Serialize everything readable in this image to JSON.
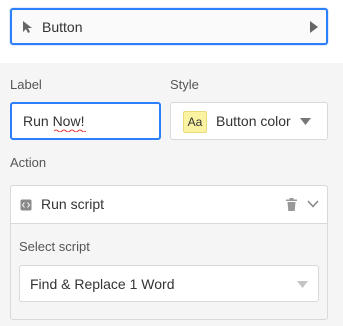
{
  "element": {
    "name": "Button"
  },
  "label_field": {
    "label": "Label",
    "value": "Run Now!"
  },
  "style_field": {
    "label": "Style",
    "swatch_text": "Aa",
    "value": "Button color",
    "swatch_color": "#fcf3a2"
  },
  "action_section": {
    "label": "Action",
    "action_title": "Run script",
    "select_label": "Select script",
    "selected_script": "Find & Replace 1 Word"
  },
  "colors": {
    "accent": "#2d7ff9",
    "panel_bg": "#f5f5f5",
    "border": "#d9d9d9"
  }
}
